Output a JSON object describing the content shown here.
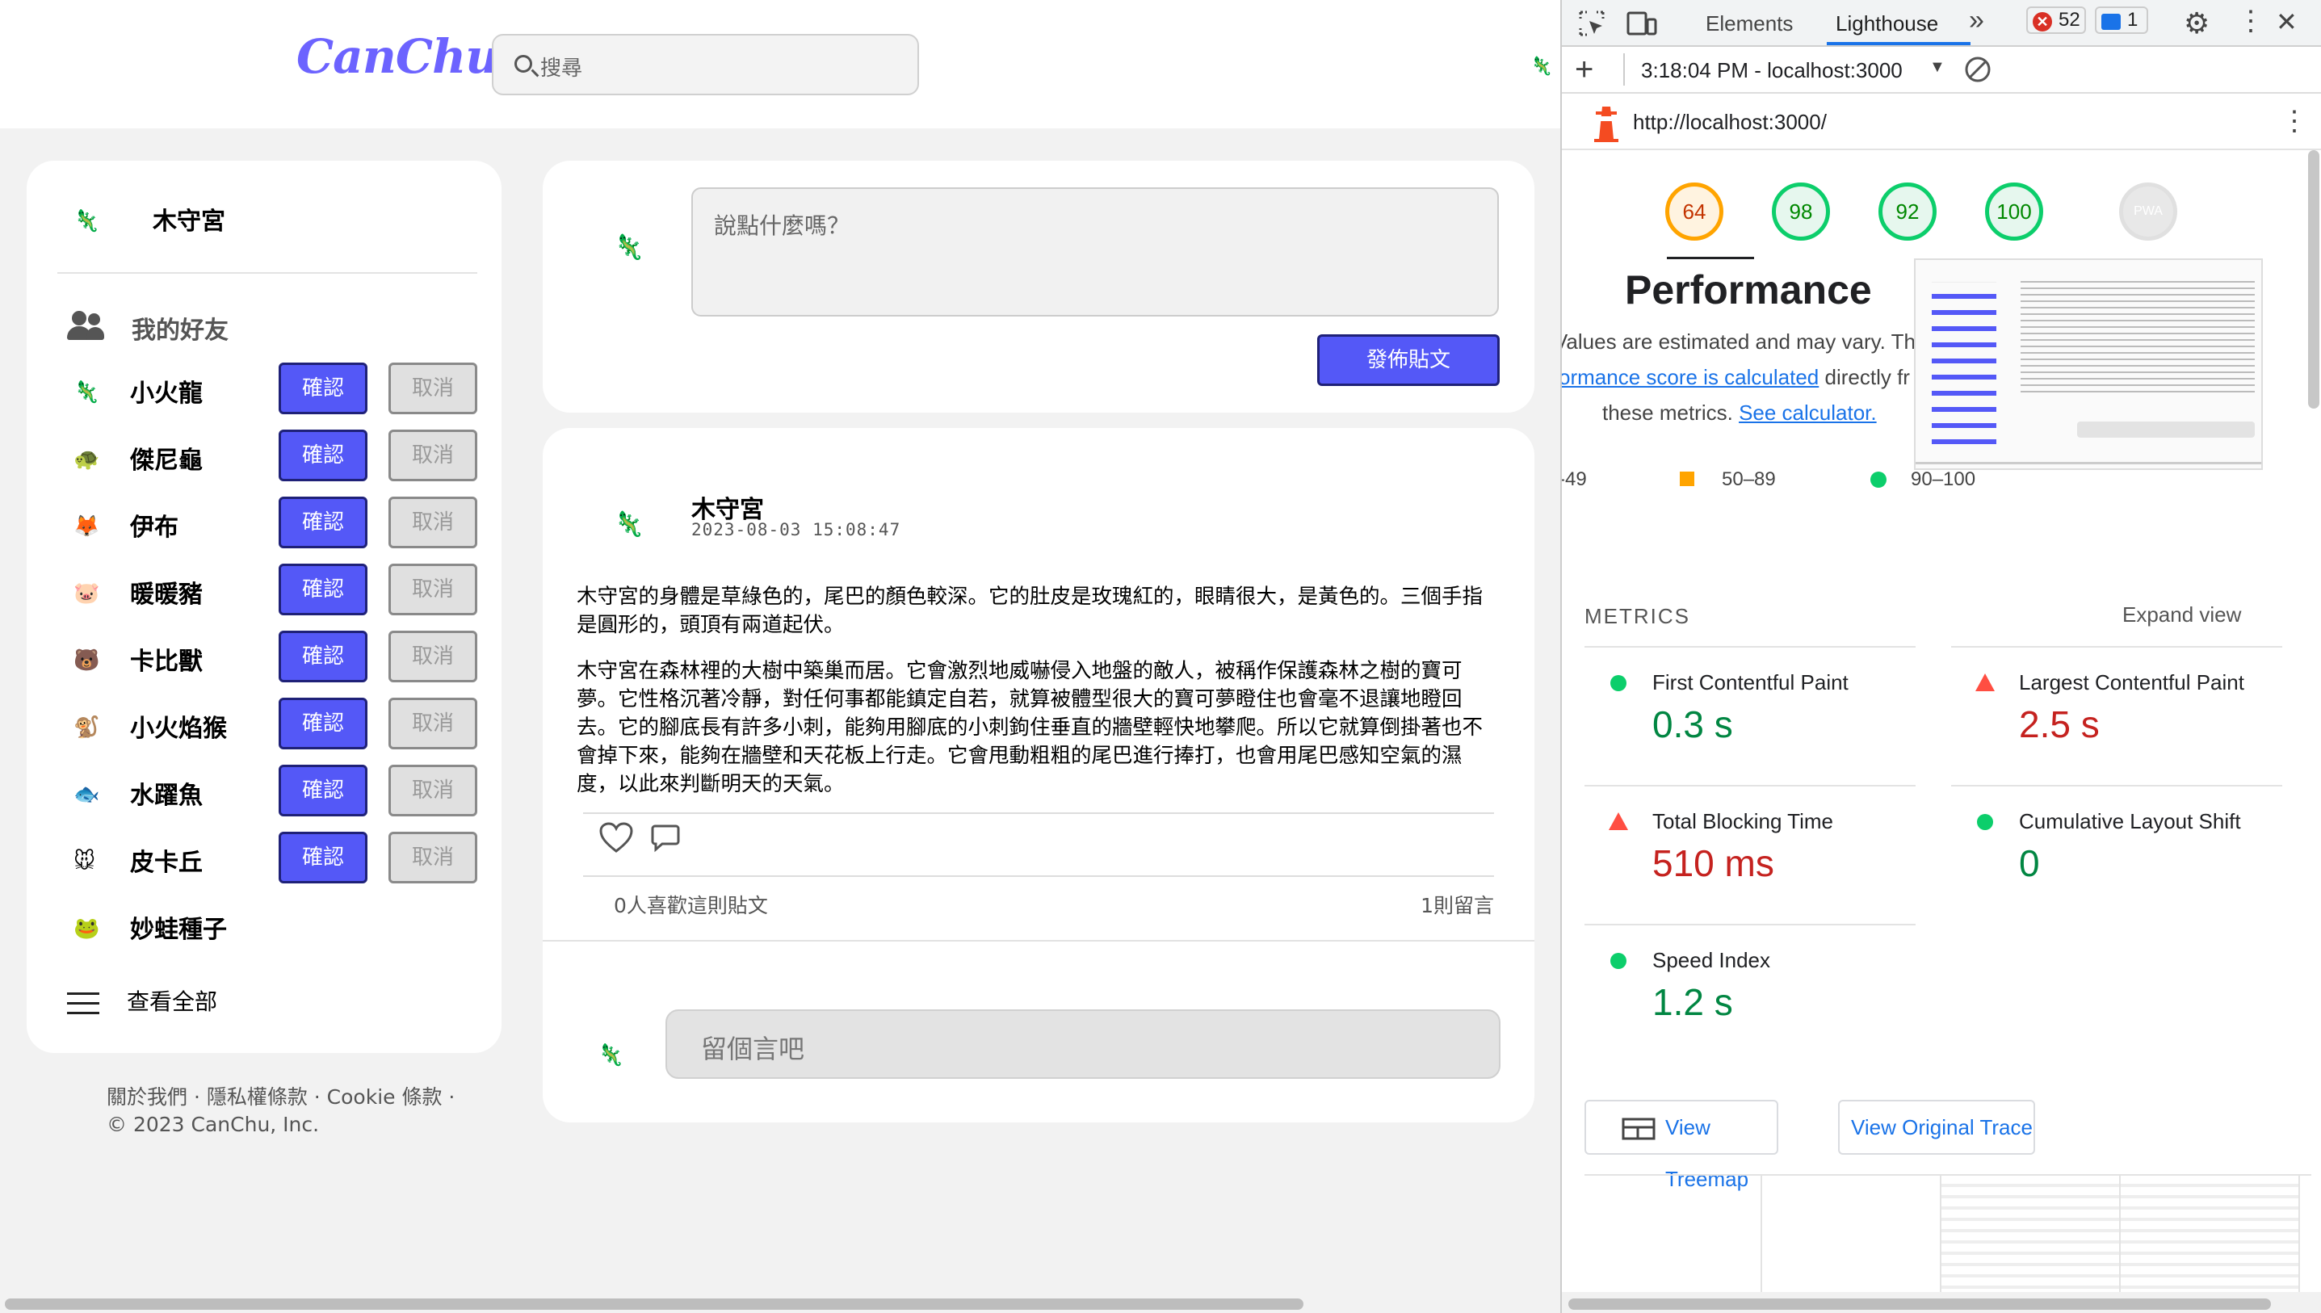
{
  "app": {
    "logo": "CanChu",
    "search_placeholder": "搜尋"
  },
  "sidebar": {
    "me_name": "木守宮",
    "friends_title": "我的好友",
    "confirm_label": "確認",
    "cancel_label": "取消",
    "friends": [
      {
        "name": "小火龍",
        "avatar": "🦎",
        "pending": true
      },
      {
        "name": "傑尼龜",
        "avatar": "🐢",
        "pending": true
      },
      {
        "name": "伊布",
        "avatar": "🦊",
        "pending": true
      },
      {
        "name": "暖暖豬",
        "avatar": "🐷",
        "pending": true
      },
      {
        "name": "卡比獸",
        "avatar": "🐻",
        "pending": true
      },
      {
        "name": "小火焰猴",
        "avatar": "🐒",
        "pending": true
      },
      {
        "name": "水躍魚",
        "avatar": "🐟",
        "pending": true
      },
      {
        "name": "皮卡丘",
        "avatar": "🐭",
        "pending": true
      },
      {
        "name": "妙蛙種子",
        "avatar": "🐸",
        "pending": false
      }
    ],
    "view_all": "查看全部",
    "footer_line1": "關於我們 · 隱私權條款 · Cookie 條款 ·",
    "footer_line2": "© 2023 CanChu, Inc."
  },
  "compose": {
    "placeholder": "說點什麼嗎？",
    "submit_label": "發佈貼文"
  },
  "post": {
    "author": "木守宮",
    "time": "2023-08-03 15:08:47",
    "paragraph1": "木守宮的身體是草綠色的，尾巴的顏色較深。它的肚皮是玫瑰紅的，眼睛很大，是黃色的。三個手指是圓形的，頭頂有兩道起伏。",
    "paragraph2": "木守宮在森林裡的大樹中築巢而居。它會激烈地威嚇侵入地盤的敵人，被稱作保護森林之樹的寶可夢。它性格沉著冷靜，對任何事都能鎮定自若，就算被體型很大的寶可夢瞪住也會毫不退讓地瞪回去。它的腳底長有許多小刺，能夠用腳底的小刺鉤住垂直的牆壁輕快地攀爬。所以它就算倒掛著也不會掉下來，能夠在牆壁和天花板上行走。它會甩動粗粗的尾巴進行捧打，也會用尾巴感知空氣的濕度，以此來判斷明天的天氣。",
    "likes_text": "0人喜歡這則貼文",
    "comments_text": "1則留言",
    "comment_placeholder": "留個言吧"
  },
  "devtools": {
    "tab_elements": "Elements",
    "tab_lighthouse": "Lighthouse",
    "more_tabs": "»",
    "errors": "52",
    "messages": "1",
    "report_time": "3:18:04 PM - localhost:3000",
    "url": "http://localhost:3000/",
    "scores": [
      {
        "value": "64",
        "color": "#c33300",
        "ring": "#ffa400",
        "bg": "#fff3e0"
      },
      {
        "value": "98",
        "color": "#008800",
        "ring": "#0cce6b",
        "bg": "#e6f7ee"
      },
      {
        "value": "92",
        "color": "#008800",
        "ring": "#0cce6b",
        "bg": "#e6f7ee"
      },
      {
        "value": "100",
        "color": "#008800",
        "ring": "#0cce6b",
        "bg": "#e6f7ee"
      }
    ],
    "pwa_label": "PWA",
    "perf_title": "Performance",
    "perf_text1": "Values are estimated and may vary. The",
    "perf_link1": "ormance score is calculated",
    "perf_text2": " directly fr",
    "perf_text3": "these metrics.",
    "perf_link2": "See calculator.",
    "legend_low": "-49",
    "legend_mid": "50–89",
    "legend_high": "90–100",
    "metrics_heading": "METRICS",
    "expand_view": "Expand view",
    "metrics": [
      {
        "label": "First Contentful Paint",
        "value": "0.3 s",
        "status": "good"
      },
      {
        "label": "Largest Contentful Paint",
        "value": "2.5 s",
        "status": "poor"
      },
      {
        "label": "Total Blocking Time",
        "value": "510 ms",
        "status": "poor"
      },
      {
        "label": "Cumulative Layout Shift",
        "value": "0",
        "status": "good"
      },
      {
        "label": "Speed Index",
        "value": "1.2 s",
        "status": "good"
      }
    ],
    "view_treemap": "View Treemap",
    "view_trace": "View Original Trace"
  }
}
